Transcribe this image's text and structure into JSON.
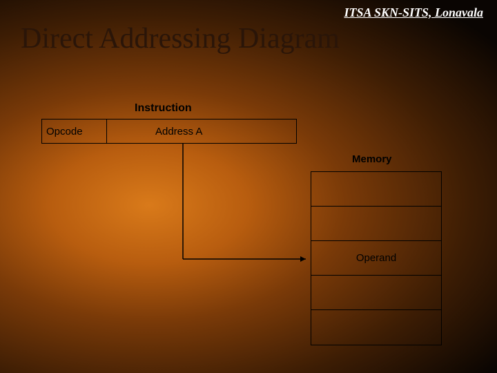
{
  "header": {
    "org": "ITSA SKN-SITS, Lonavala"
  },
  "title": "Direct Addressing Diagram",
  "instruction": {
    "label": "Instruction",
    "opcode": "Opcode",
    "address": "Address A"
  },
  "memory": {
    "label": "Memory",
    "cells": [
      "",
      "",
      "Operand",
      "",
      ""
    ]
  }
}
